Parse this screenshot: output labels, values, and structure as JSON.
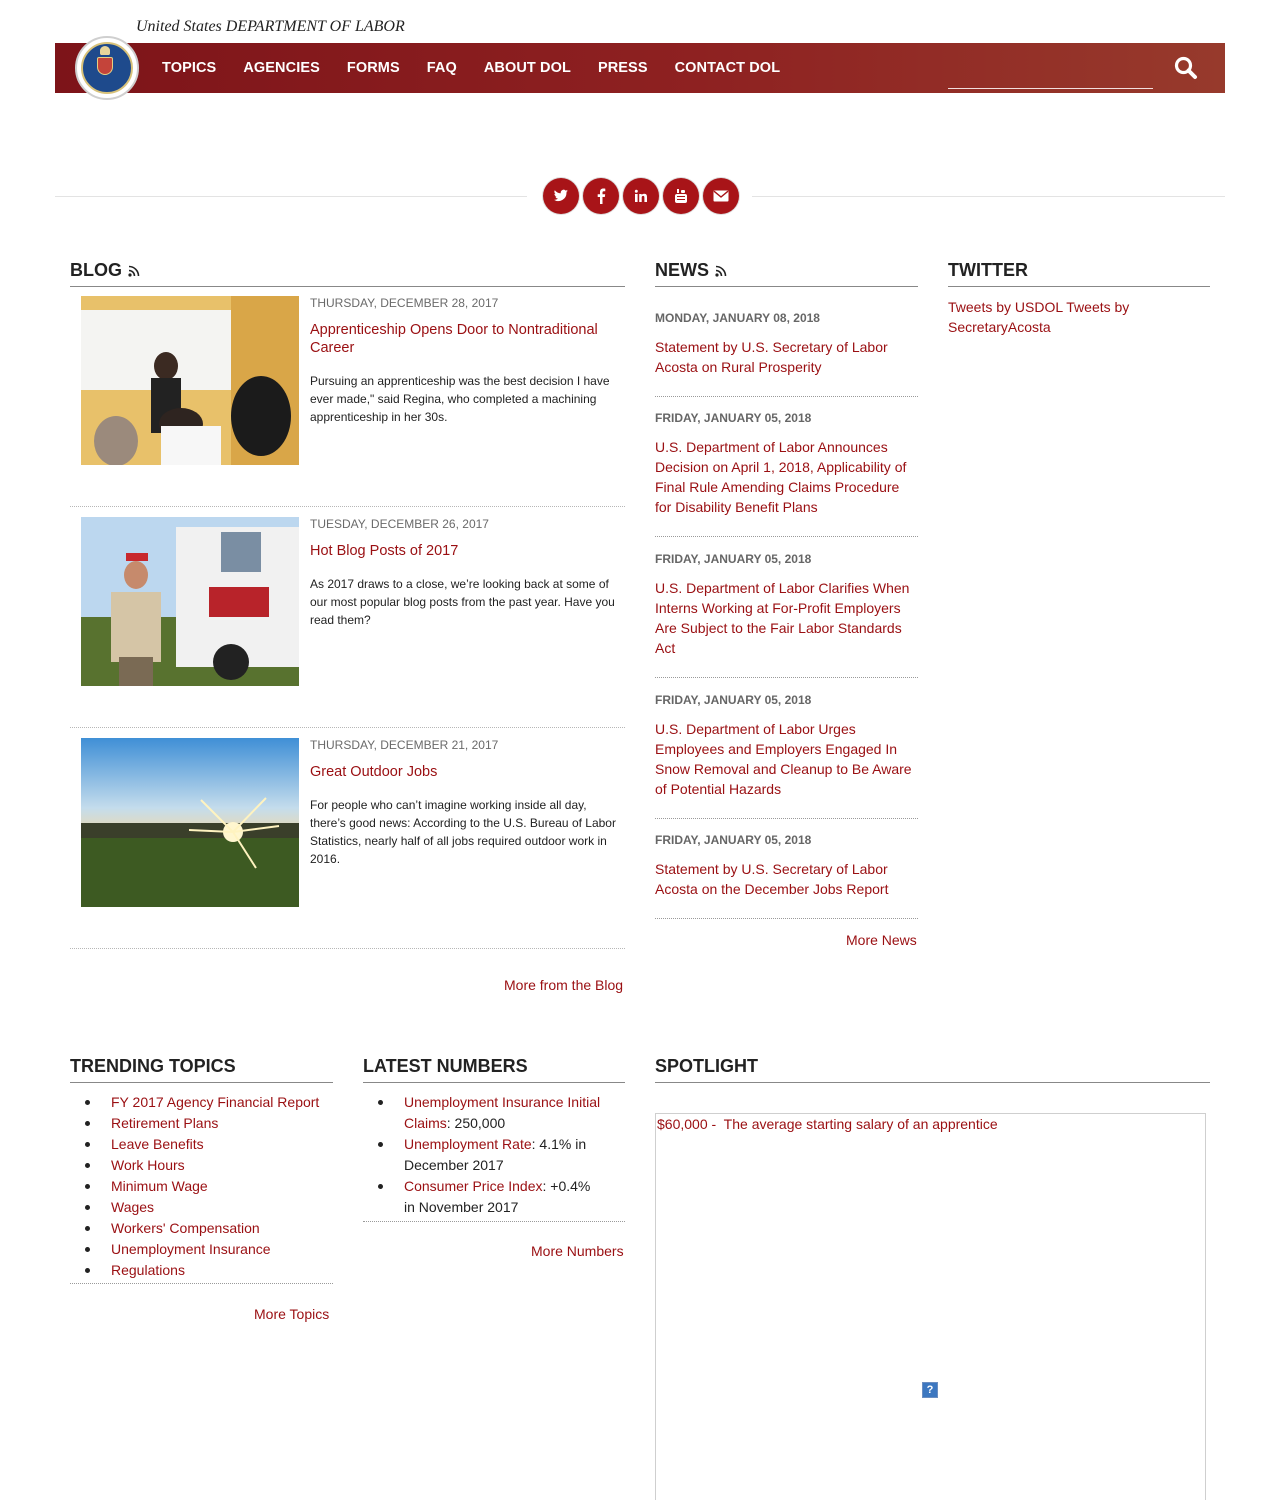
{
  "header": {
    "agency_name": "United States DEPARTMENT OF LABOR",
    "nav": [
      "TOPICS",
      "AGENCIES",
      "FORMS",
      "FAQ",
      "ABOUT DOL",
      "PRESS",
      "CONTACT DOL"
    ],
    "search_placeholder": ""
  },
  "social": {
    "icons": [
      "twitter-icon",
      "facebook-icon",
      "linkedin-icon",
      "youtube-icon",
      "email-icon"
    ]
  },
  "blog": {
    "title": "BLOG",
    "items": [
      {
        "date": "THURSDAY, DECEMBER 28, 2017",
        "title": "Apprenticeship Opens Door to Nontraditional Career",
        "text": "Pursuing an apprenticeship was the best decision I have ever made,\" said Regina, who completed a machining apprenticeship in her 30s."
      },
      {
        "date": "TUESDAY, DECEMBER 26, 2017",
        "title": "Hot Blog Posts of 2017",
        "text": "As 2017 draws to a close, we’re looking back at some of our most popular blog posts from the past year. Have you read them?"
      },
      {
        "date": "THURSDAY, DECEMBER 21, 2017",
        "title": "Great Outdoor Jobs",
        "text": "For people who can’t imagine working inside all day, there’s good news: According to the U.S. Bureau of Labor Statistics, nearly half of all jobs required outdoor work in 2016."
      }
    ],
    "more": "More from the Blog"
  },
  "news": {
    "title": "NEWS",
    "items": [
      {
        "date": "MONDAY, JANUARY 08, 2018",
        "title": "Statement by U.S. Secretary of Labor Acosta on Rural Prosperity"
      },
      {
        "date": "FRIDAY, JANUARY 05, 2018",
        "title": "U.S. Department of Labor Announces Decision on April 1, 2018, Applicability of Final Rule Amending Claims Procedure for Disability Benefit Plans"
      },
      {
        "date": "FRIDAY, JANUARY 05, 2018",
        "title": "U.S. Department of Labor Clarifies When Interns Working at For-Profit Employers Are Subject to the Fair Labor Standards Act"
      },
      {
        "date": "FRIDAY, JANUARY 05, 2018",
        "title": "U.S. Department of Labor Urges Employees and Employers Engaged In Snow Removal and Cleanup to Be Aware of Potential Hazards"
      },
      {
        "date": "FRIDAY, JANUARY 05, 2018",
        "title": "Statement by U.S. Secretary of Labor Acosta on the December Jobs Report"
      }
    ],
    "more": "More News"
  },
  "twitter": {
    "title": "TWITTER",
    "text": "Tweets by USDOL Tweets by SecretaryAcosta"
  },
  "trending": {
    "title": "TRENDING TOPICS",
    "items": [
      "FY 2017 Agency Financial Report",
      "Retirement Plans",
      "Leave Benefits",
      "Work Hours",
      "Minimum Wage",
      "Wages",
      "Workers' Compensation",
      "Unemployment Insurance",
      "Regulations"
    ],
    "more": "More Topics"
  },
  "numbers": {
    "title": "LATEST NUMBERS",
    "items": [
      {
        "label": "Unemployment Insurance Initial Claims",
        "value": ": 250,000"
      },
      {
        "label": "Unemployment Rate",
        "value": ": 4.1% in December 2017"
      },
      {
        "label": "Consumer Price Index",
        "value": ": +0.4% in November 2017"
      }
    ],
    "more": "More Numbers"
  },
  "spotlight": {
    "title": "SPOTLIGHT",
    "caption": "$60,000 -  The average starting salary of an apprentice",
    "broken_image_glyph": "?"
  },
  "colors": {
    "brand_red": "#9a0f12",
    "nav_bg": "#8e2121",
    "social_red": "#a81418"
  }
}
